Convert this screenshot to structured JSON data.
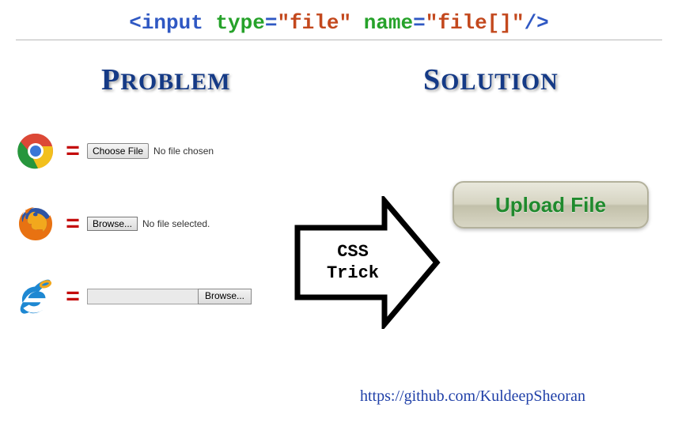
{
  "code_line": {
    "open": "<",
    "tag": "input",
    "attr1": "type",
    "val1": "\"file\"",
    "attr2": "name",
    "val2": "\"file[]\"",
    "close": "/>"
  },
  "headings": {
    "problem_first": "P",
    "problem_rest": "ROBLEM",
    "solution_first": "S",
    "solution_rest": "OLUTION"
  },
  "rows": {
    "chrome": {
      "eq": "=",
      "button": "Choose File",
      "status": "No file chosen"
    },
    "firefox": {
      "eq": "=",
      "button": "Browse...",
      "status": "No file selected."
    },
    "ie": {
      "eq": "=",
      "button": "Browse..."
    }
  },
  "arrow": {
    "line1": "CSS",
    "line2": "Trick"
  },
  "upload": {
    "label": "Upload File"
  },
  "footer": {
    "url": "https://github.com/KuldeepSheoran"
  }
}
